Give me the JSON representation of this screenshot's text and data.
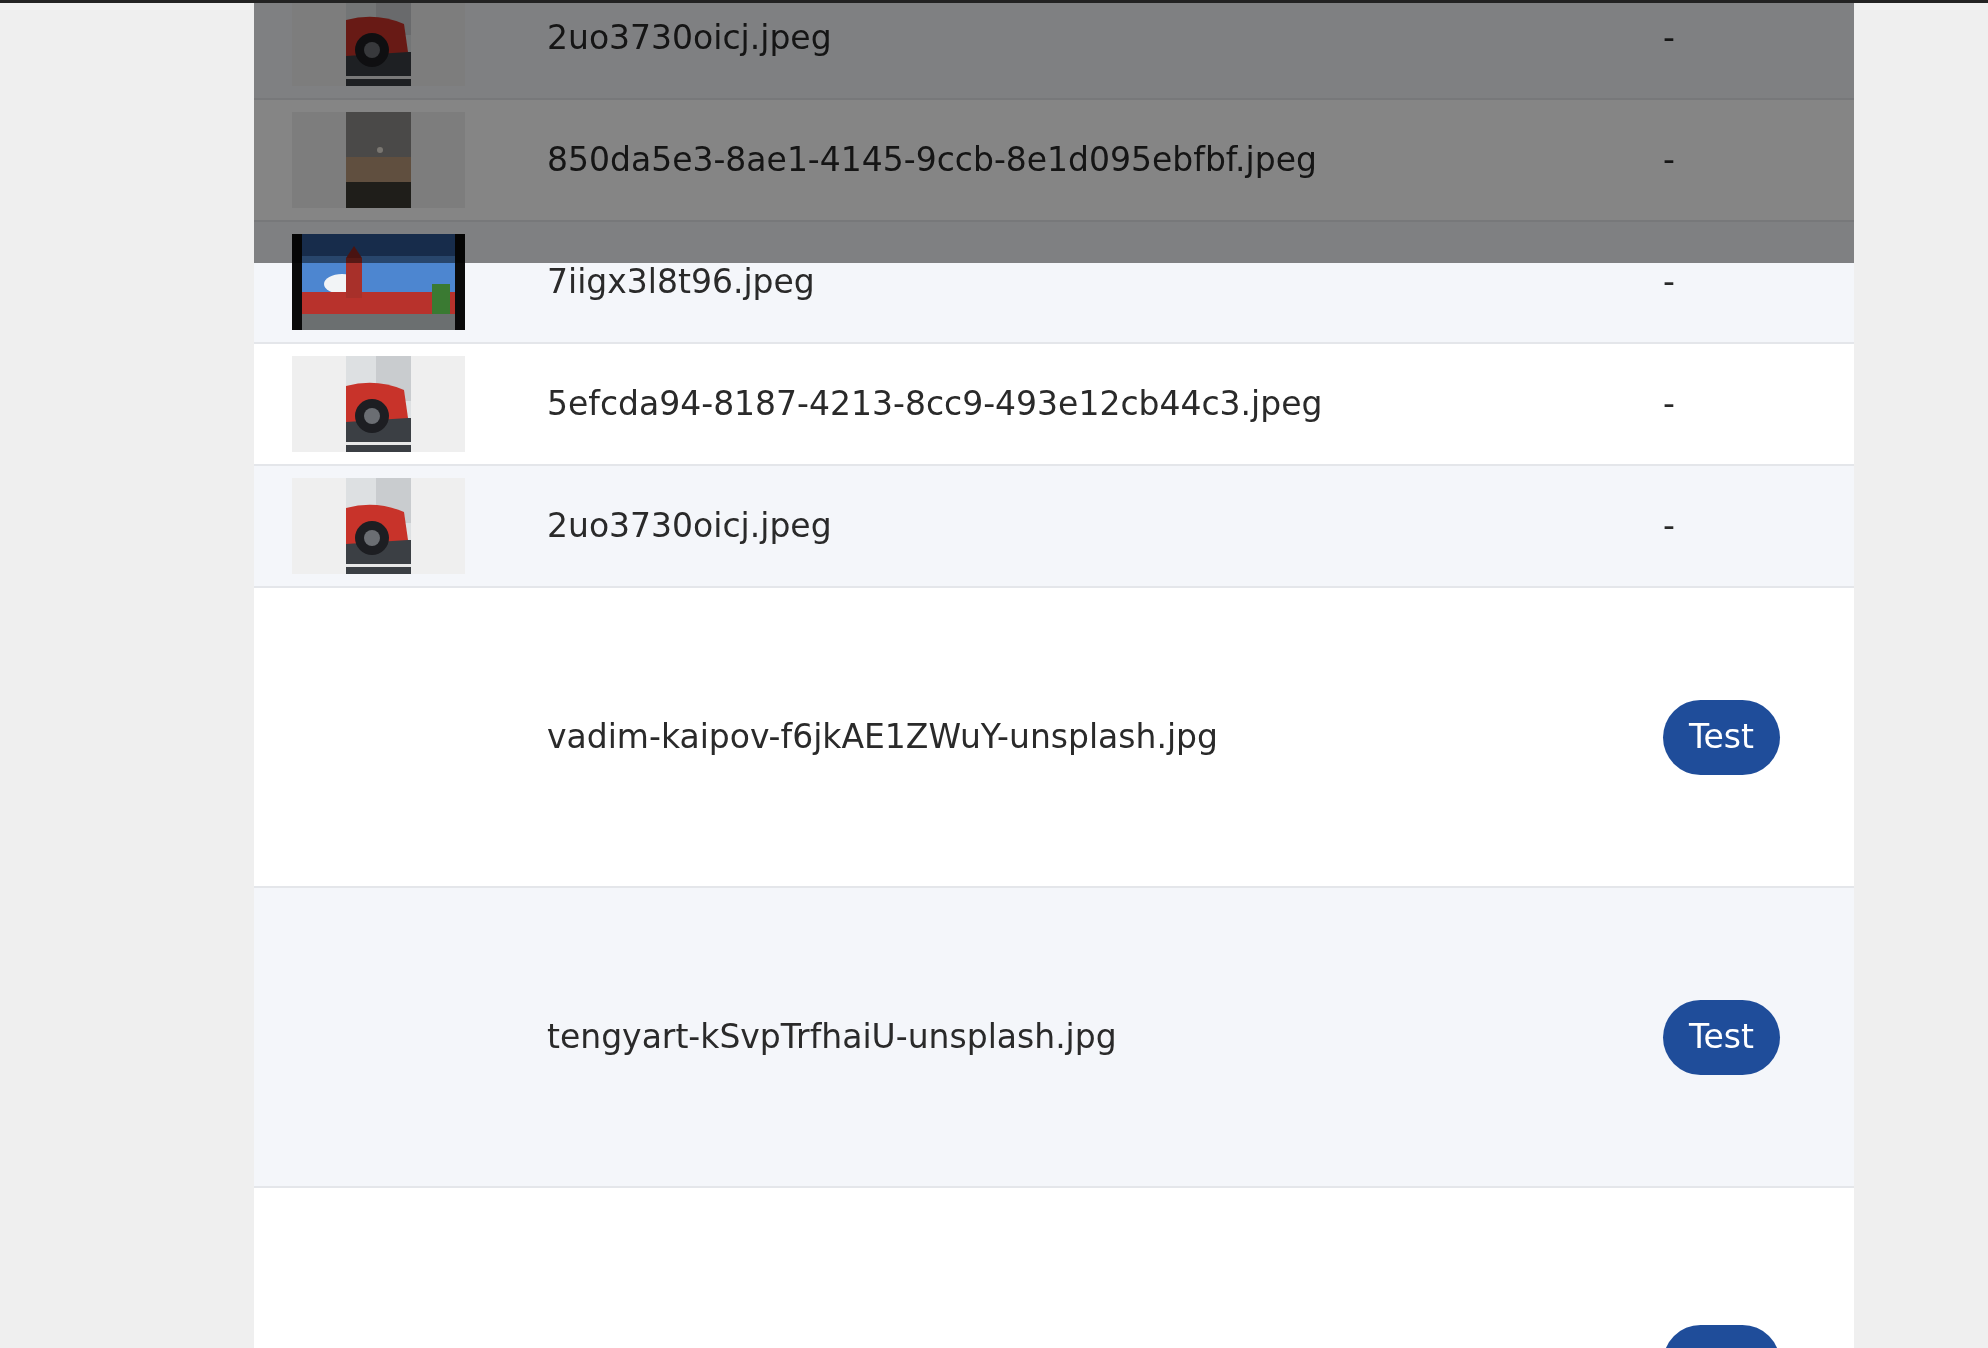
{
  "backdrop": {
    "shown": true
  },
  "rows": [
    {
      "kind": "thumb",
      "name": "2uo3730oicj.jpeg",
      "status": "-"
    },
    {
      "kind": "thumb",
      "name": "850da5e3-8ae1-4145-9ccb-8e1d095ebfbf.jpeg",
      "status": "-"
    },
    {
      "kind": "thumb",
      "name": "7iigx3l8t96.jpeg",
      "status": "-"
    },
    {
      "kind": "thumb",
      "name": "5efcda94-8187-4213-8cc9-493e12cb44c3.jpeg",
      "status": "-"
    },
    {
      "kind": "thumb",
      "name": "2uo3730oicj.jpeg",
      "status": "-"
    },
    {
      "kind": "file",
      "name": "vadim-kaipov-f6jkAE1ZWuY-unsplash.jpg",
      "button": "Test"
    },
    {
      "kind": "file",
      "name": "tengyart-kSvpTrfhaiU-unsplash.jpg",
      "button": "Test"
    },
    {
      "kind": "cutoff"
    }
  ]
}
